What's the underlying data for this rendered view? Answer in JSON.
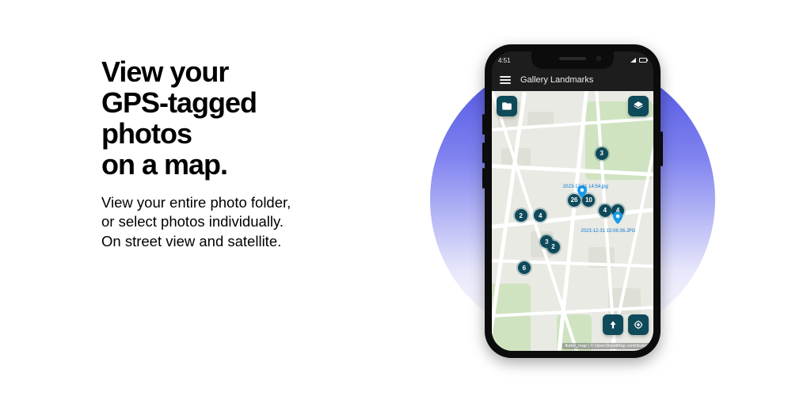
{
  "marketing": {
    "headline_l1": "View your",
    "headline_l2": "GPS-tagged",
    "headline_l3": "photos",
    "headline_l4": "on a map.",
    "sub_l1": "View your entire photo folder,",
    "sub_l2": "or select photos individually.",
    "sub_l3": "On street view and satellite."
  },
  "phone": {
    "status_time": "4:51",
    "app_title": "Gallery Landmarks",
    "pin_label_1": "2023-12-31 14:54.jpg",
    "pin_label_2": "2023-12-31 15:06:36.JPG",
    "attribution": "flutter_map | © OpenStreetMap contributors",
    "clusters": {
      "c1": "3",
      "c2": "26",
      "c3": "10",
      "c4": "4",
      "c5": "2",
      "c6": "4",
      "c7": "3",
      "c8": "2",
      "c9": "6",
      "c10": "4"
    }
  }
}
